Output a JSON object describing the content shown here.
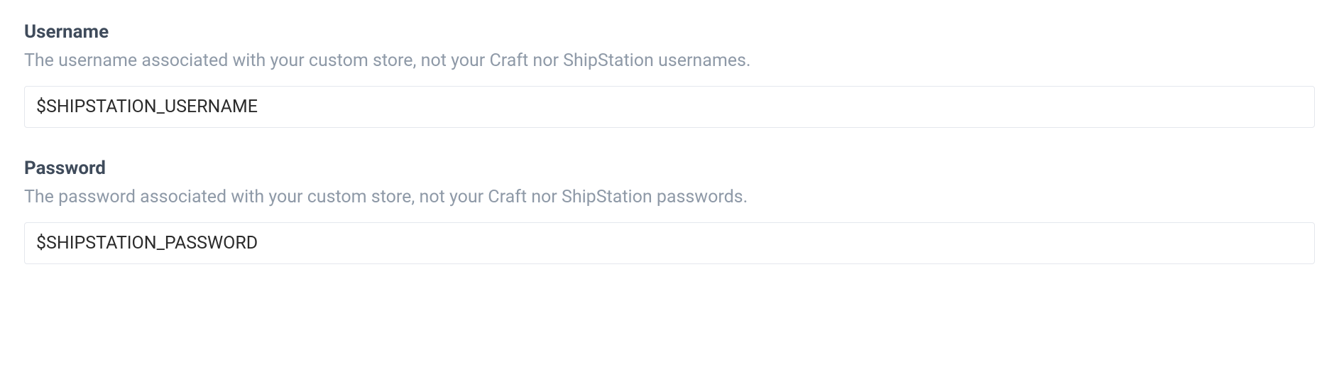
{
  "fields": {
    "username": {
      "label": "Username",
      "help": "The username associated with your custom store, not your Craft nor ShipStation usernames.",
      "value": "$SHIPSTATION_USERNAME"
    },
    "password": {
      "label": "Password",
      "help": "The password associated with your custom store, not your Craft nor ShipStation passwords.",
      "value": "$SHIPSTATION_PASSWORD"
    }
  }
}
